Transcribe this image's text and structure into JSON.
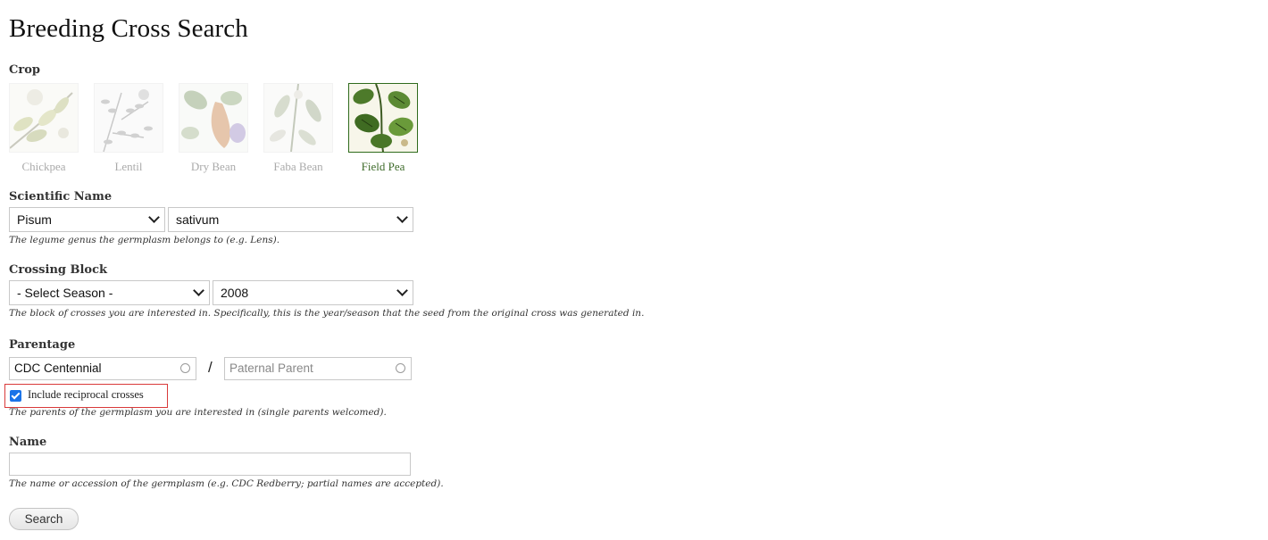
{
  "page": {
    "title": "Breeding Cross Search"
  },
  "crop": {
    "label": "Crop",
    "options": [
      {
        "name": "Chickpea",
        "selected": false
      },
      {
        "name": "Lentil",
        "selected": false
      },
      {
        "name": "Dry Bean",
        "selected": false
      },
      {
        "name": "Faba Bean",
        "selected": false
      },
      {
        "name": "Field Pea",
        "selected": true
      }
    ]
  },
  "scientific_name": {
    "label": "Scientific Name",
    "genus": "Pisum",
    "species": "sativum",
    "description": "The legume genus the germplasm belongs to (e.g. Lens)."
  },
  "crossing_block": {
    "label": "Crossing Block",
    "season": "- Select Season -",
    "year": "2008",
    "description": "The block of crosses you are interested in. Specifically, this is the year/season that the seed from the original cross was generated in."
  },
  "parentage": {
    "label": "Parentage",
    "maternal_value": "CDC Centennial",
    "separator": "/",
    "paternal_placeholder": "Paternal Parent",
    "reciprocal_label": "Include reciprocal crosses",
    "reciprocal_checked": true,
    "description": "The parents of the germplasm you are interested in (single parents welcomed)."
  },
  "name": {
    "label": "Name",
    "value": "",
    "description": "The name or accession of the germplasm (e.g. CDC Redberry; partial names are accepted)."
  },
  "search_button": {
    "label": "Search"
  },
  "colors": {
    "selected_crop": "#3e6b2a",
    "highlight_border": "#d93a3a",
    "checkbox": "#1a73e8"
  }
}
